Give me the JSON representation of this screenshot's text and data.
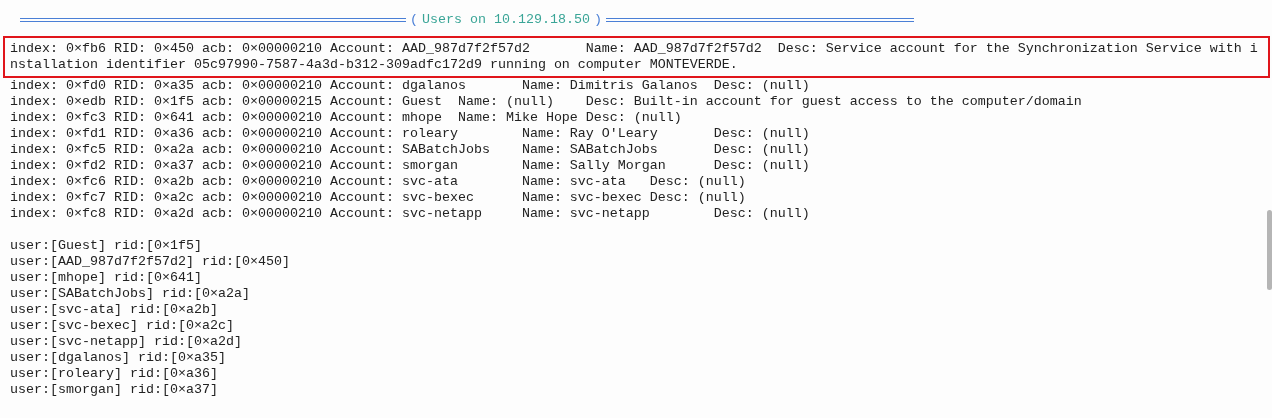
{
  "header": {
    "open": "(",
    "title": "Users on 10.129.18.50",
    "close": ")"
  },
  "accounts": [
    {
      "text": "index: 0×fb6 RID: 0×450 acb: 0×00000210 Account: AAD_987d7f2f57d2       Name: AAD_987d7f2f57d2  Desc: Service account for the Synchronization Service with installation identifier 05c97990-7587-4a3d-b312-309adfc172d9 running on computer MONTEVERDE.",
      "highlighted": true
    },
    {
      "text": "index: 0×fd0 RID: 0×a35 acb: 0×00000210 Account: dgalanos       Name: Dimitris Galanos  Desc: (null)",
      "highlighted": false
    },
    {
      "text": "index: 0×edb RID: 0×1f5 acb: 0×00000215 Account: Guest  Name: (null)    Desc: Built-in account for guest access to the computer/domain",
      "highlighted": false
    },
    {
      "text": "index: 0×fc3 RID: 0×641 acb: 0×00000210 Account: mhope  Name: Mike Hope Desc: (null)",
      "highlighted": false
    },
    {
      "text": "index: 0×fd1 RID: 0×a36 acb: 0×00000210 Account: roleary        Name: Ray O'Leary       Desc: (null)",
      "highlighted": false
    },
    {
      "text": "index: 0×fc5 RID: 0×a2a acb: 0×00000210 Account: SABatchJobs    Name: SABatchJobs       Desc: (null)",
      "highlighted": false
    },
    {
      "text": "index: 0×fd2 RID: 0×a37 acb: 0×00000210 Account: smorgan        Name: Sally Morgan      Desc: (null)",
      "highlighted": false
    },
    {
      "text": "index: 0×fc6 RID: 0×a2b acb: 0×00000210 Account: svc-ata        Name: svc-ata   Desc: (null)",
      "highlighted": false
    },
    {
      "text": "index: 0×fc7 RID: 0×a2c acb: 0×00000210 Account: svc-bexec      Name: svc-bexec Desc: (null)",
      "highlighted": false
    },
    {
      "text": "index: 0×fc8 RID: 0×a2d acb: 0×00000210 Account: svc-netapp     Name: svc-netapp        Desc: (null)",
      "highlighted": false
    }
  ],
  "users": [
    "user:[Guest] rid:[0×1f5]",
    "user:[AAD_987d7f2f57d2] rid:[0×450]",
    "user:[mhope] rid:[0×641]",
    "user:[SABatchJobs] rid:[0×a2a]",
    "user:[svc-ata] rid:[0×a2b]",
    "user:[svc-bexec] rid:[0×a2c]",
    "user:[svc-netapp] rid:[0×a2d]",
    "user:[dgalanos] rid:[0×a35]",
    "user:[roleary] rid:[0×a36]",
    "user:[smorgan] rid:[0×a37]"
  ]
}
